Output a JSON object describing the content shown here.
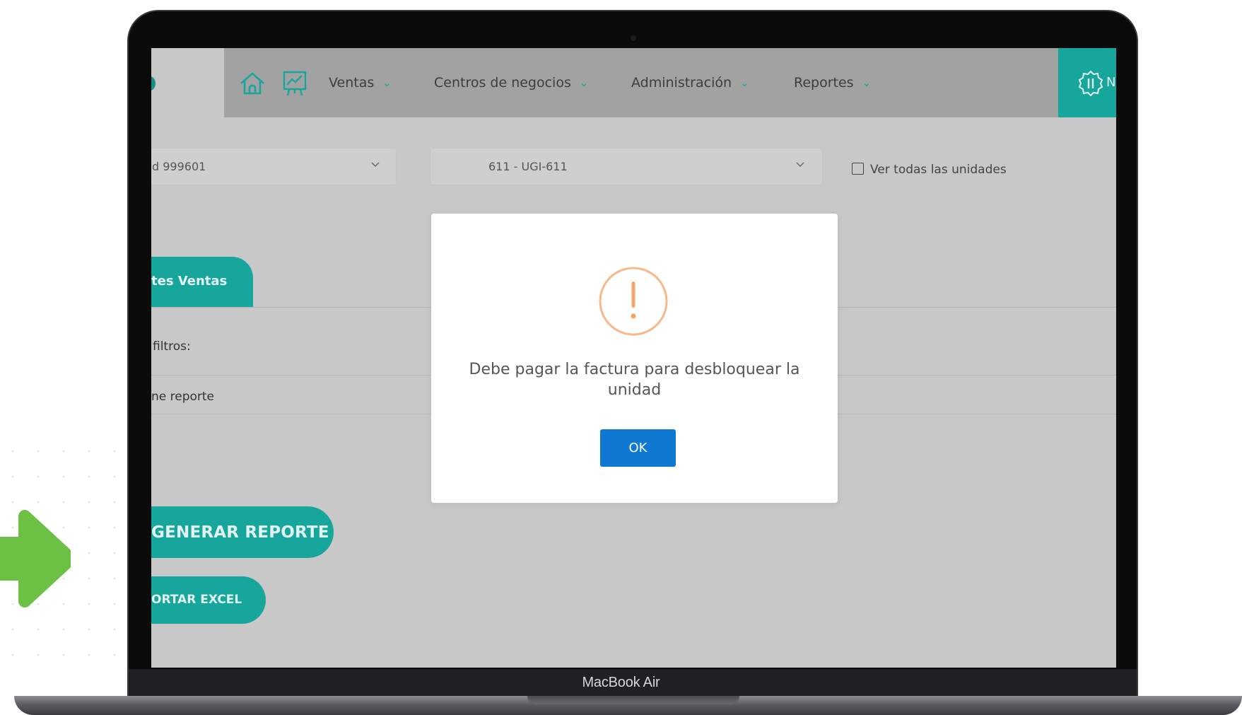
{
  "device": {
    "label": "MacBook Air"
  },
  "nav": {
    "items": [
      {
        "label": "Ventas"
      },
      {
        "label": "Centros de negocios"
      },
      {
        "label": "Administración"
      },
      {
        "label": "Reportes"
      }
    ],
    "novedades_label": "Novedades"
  },
  "selectors": {
    "unit": {
      "value": "d 999601"
    },
    "business_center": {
      "value": "611 - UGI-611"
    },
    "show_all_units": {
      "label": "Ver todas las unidades",
      "checked": false
    }
  },
  "tab": {
    "label": "tes Ventas"
  },
  "filters": {
    "label": "filtros:",
    "report_label": "ne reporte"
  },
  "actions": {
    "generate_label": "GENERAR REPORTE",
    "export_label": "ORTAR EXCEL"
  },
  "modal": {
    "message": "Debe pagar la factura para desbloquear la unidad",
    "ok_label": "OK"
  },
  "colors": {
    "accent_teal": "#17a69c",
    "ok_blue": "#0f79d2",
    "warning_orange": "#f5b98b",
    "deco_green": "#6cc144"
  },
  "icons": [
    "home-icon",
    "chart-icon",
    "novedades-icon",
    "warning-icon",
    "chevron-down-icon",
    "arrow-right-icon"
  ]
}
